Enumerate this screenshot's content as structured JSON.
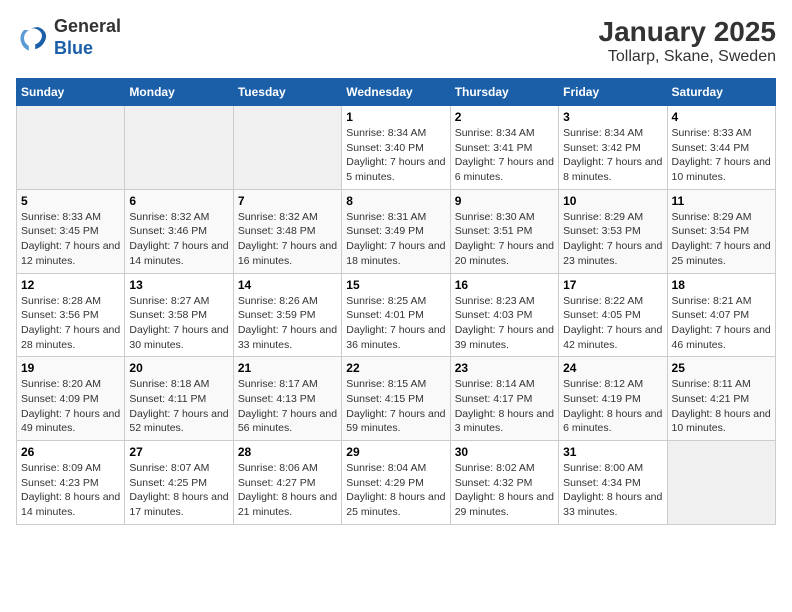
{
  "logo": {
    "general": "General",
    "blue": "Blue"
  },
  "title": "January 2025",
  "subtitle": "Tollarp, Skane, Sweden",
  "days_of_week": [
    "Sunday",
    "Monday",
    "Tuesday",
    "Wednesday",
    "Thursday",
    "Friday",
    "Saturday"
  ],
  "weeks": [
    [
      {
        "day": "",
        "info": ""
      },
      {
        "day": "",
        "info": ""
      },
      {
        "day": "",
        "info": ""
      },
      {
        "day": "1",
        "info": "Sunrise: 8:34 AM\nSunset: 3:40 PM\nDaylight: 7 hours and 5 minutes."
      },
      {
        "day": "2",
        "info": "Sunrise: 8:34 AM\nSunset: 3:41 PM\nDaylight: 7 hours and 6 minutes."
      },
      {
        "day": "3",
        "info": "Sunrise: 8:34 AM\nSunset: 3:42 PM\nDaylight: 7 hours and 8 minutes."
      },
      {
        "day": "4",
        "info": "Sunrise: 8:33 AM\nSunset: 3:44 PM\nDaylight: 7 hours and 10 minutes."
      }
    ],
    [
      {
        "day": "5",
        "info": "Sunrise: 8:33 AM\nSunset: 3:45 PM\nDaylight: 7 hours and 12 minutes."
      },
      {
        "day": "6",
        "info": "Sunrise: 8:32 AM\nSunset: 3:46 PM\nDaylight: 7 hours and 14 minutes."
      },
      {
        "day": "7",
        "info": "Sunrise: 8:32 AM\nSunset: 3:48 PM\nDaylight: 7 hours and 16 minutes."
      },
      {
        "day": "8",
        "info": "Sunrise: 8:31 AM\nSunset: 3:49 PM\nDaylight: 7 hours and 18 minutes."
      },
      {
        "day": "9",
        "info": "Sunrise: 8:30 AM\nSunset: 3:51 PM\nDaylight: 7 hours and 20 minutes."
      },
      {
        "day": "10",
        "info": "Sunrise: 8:29 AM\nSunset: 3:53 PM\nDaylight: 7 hours and 23 minutes."
      },
      {
        "day": "11",
        "info": "Sunrise: 8:29 AM\nSunset: 3:54 PM\nDaylight: 7 hours and 25 minutes."
      }
    ],
    [
      {
        "day": "12",
        "info": "Sunrise: 8:28 AM\nSunset: 3:56 PM\nDaylight: 7 hours and 28 minutes."
      },
      {
        "day": "13",
        "info": "Sunrise: 8:27 AM\nSunset: 3:58 PM\nDaylight: 7 hours and 30 minutes."
      },
      {
        "day": "14",
        "info": "Sunrise: 8:26 AM\nSunset: 3:59 PM\nDaylight: 7 hours and 33 minutes."
      },
      {
        "day": "15",
        "info": "Sunrise: 8:25 AM\nSunset: 4:01 PM\nDaylight: 7 hours and 36 minutes."
      },
      {
        "day": "16",
        "info": "Sunrise: 8:23 AM\nSunset: 4:03 PM\nDaylight: 7 hours and 39 minutes."
      },
      {
        "day": "17",
        "info": "Sunrise: 8:22 AM\nSunset: 4:05 PM\nDaylight: 7 hours and 42 minutes."
      },
      {
        "day": "18",
        "info": "Sunrise: 8:21 AM\nSunset: 4:07 PM\nDaylight: 7 hours and 46 minutes."
      }
    ],
    [
      {
        "day": "19",
        "info": "Sunrise: 8:20 AM\nSunset: 4:09 PM\nDaylight: 7 hours and 49 minutes."
      },
      {
        "day": "20",
        "info": "Sunrise: 8:18 AM\nSunset: 4:11 PM\nDaylight: 7 hours and 52 minutes."
      },
      {
        "day": "21",
        "info": "Sunrise: 8:17 AM\nSunset: 4:13 PM\nDaylight: 7 hours and 56 minutes."
      },
      {
        "day": "22",
        "info": "Sunrise: 8:15 AM\nSunset: 4:15 PM\nDaylight: 7 hours and 59 minutes."
      },
      {
        "day": "23",
        "info": "Sunrise: 8:14 AM\nSunset: 4:17 PM\nDaylight: 8 hours and 3 minutes."
      },
      {
        "day": "24",
        "info": "Sunrise: 8:12 AM\nSunset: 4:19 PM\nDaylight: 8 hours and 6 minutes."
      },
      {
        "day": "25",
        "info": "Sunrise: 8:11 AM\nSunset: 4:21 PM\nDaylight: 8 hours and 10 minutes."
      }
    ],
    [
      {
        "day": "26",
        "info": "Sunrise: 8:09 AM\nSunset: 4:23 PM\nDaylight: 8 hours and 14 minutes."
      },
      {
        "day": "27",
        "info": "Sunrise: 8:07 AM\nSunset: 4:25 PM\nDaylight: 8 hours and 17 minutes."
      },
      {
        "day": "28",
        "info": "Sunrise: 8:06 AM\nSunset: 4:27 PM\nDaylight: 8 hours and 21 minutes."
      },
      {
        "day": "29",
        "info": "Sunrise: 8:04 AM\nSunset: 4:29 PM\nDaylight: 8 hours and 25 minutes."
      },
      {
        "day": "30",
        "info": "Sunrise: 8:02 AM\nSunset: 4:32 PM\nDaylight: 8 hours and 29 minutes."
      },
      {
        "day": "31",
        "info": "Sunrise: 8:00 AM\nSunset: 4:34 PM\nDaylight: 8 hours and 33 minutes."
      },
      {
        "day": "",
        "info": ""
      }
    ]
  ]
}
